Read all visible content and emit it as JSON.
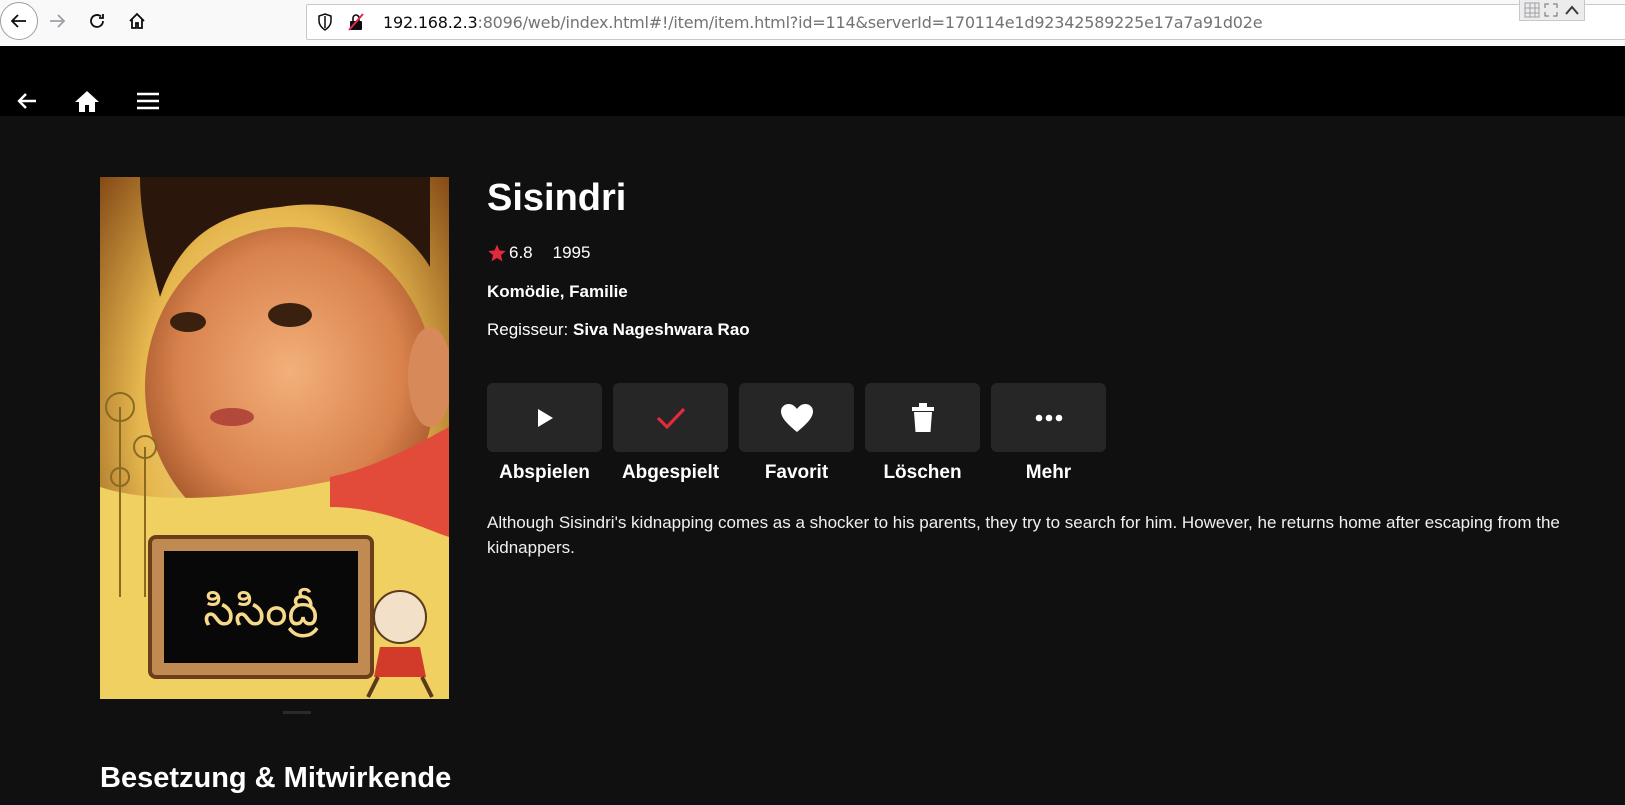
{
  "browser": {
    "url_host": "192.168.2.3",
    "url_rest": ":8096/web/index.html#!/item/item.html?id=114&serverId=170114e1d92342589225e17a7a91d02e"
  },
  "item": {
    "title": "Sisindri",
    "rating": "6.8",
    "year": "1995",
    "genres": "Komödie, Familie",
    "director_label": "Regisseur: ",
    "director_name": "Siva Nageshwara Rao",
    "overview": "Although Sisindri's kidnapping comes as a shocker to his parents, they try to search for him. However, he returns home after escaping from the kidnappers.",
    "poster_text": "సిసింద్రీ"
  },
  "actions": {
    "play": "Abspielen",
    "played": "Abgespielt",
    "favorite": "Favorit",
    "delete": "Löschen",
    "more": "Mehr"
  },
  "sections": {
    "cast": "Besetzung & Mitwirkende"
  },
  "colors": {
    "accent_red": "#e02b3c",
    "background": "#101010",
    "header": "#000000",
    "button": "#262626"
  }
}
